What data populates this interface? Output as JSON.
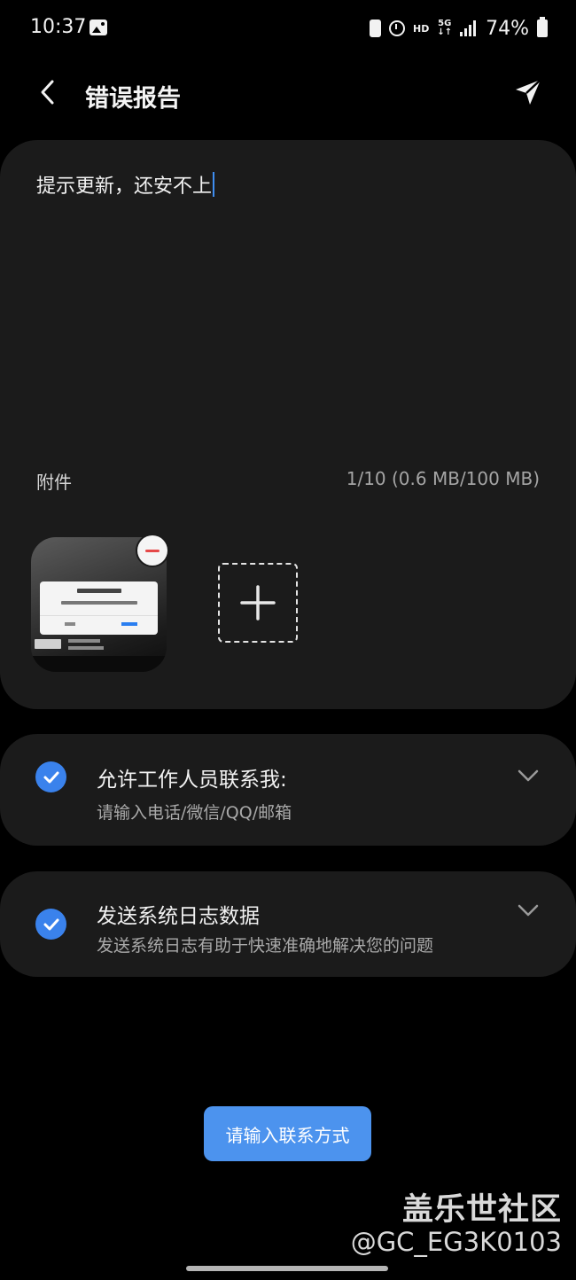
{
  "status_bar": {
    "time": "10:37",
    "hd": "HD",
    "network": "5G",
    "battery": "74%"
  },
  "header": {
    "title": "错误报告",
    "back_icon": "chevron-left-icon",
    "send_icon": "send-icon"
  },
  "report": {
    "text": "提示更新，还安不上",
    "attachments_label": "附件",
    "attachments_count": "1/10 (0.6 MB/100 MB)"
  },
  "options": {
    "contact": {
      "title": "允许工作人员联系我:",
      "placeholder": "请输入电话/微信/QQ/邮箱",
      "checked": true
    },
    "logs": {
      "title": "发送系统日志数据",
      "subtitle": "发送系统日志有助于快速准确地解决您的问题",
      "checked": true
    }
  },
  "action_button": "请输入联系方式",
  "watermark": {
    "logo": "盖乐世社区",
    "user": "@GC_EG3K0103"
  },
  "colors": {
    "accent": "#3a82ec",
    "button": "#4c93ee",
    "card": "#1b1b1b",
    "remove": "#e54848"
  }
}
